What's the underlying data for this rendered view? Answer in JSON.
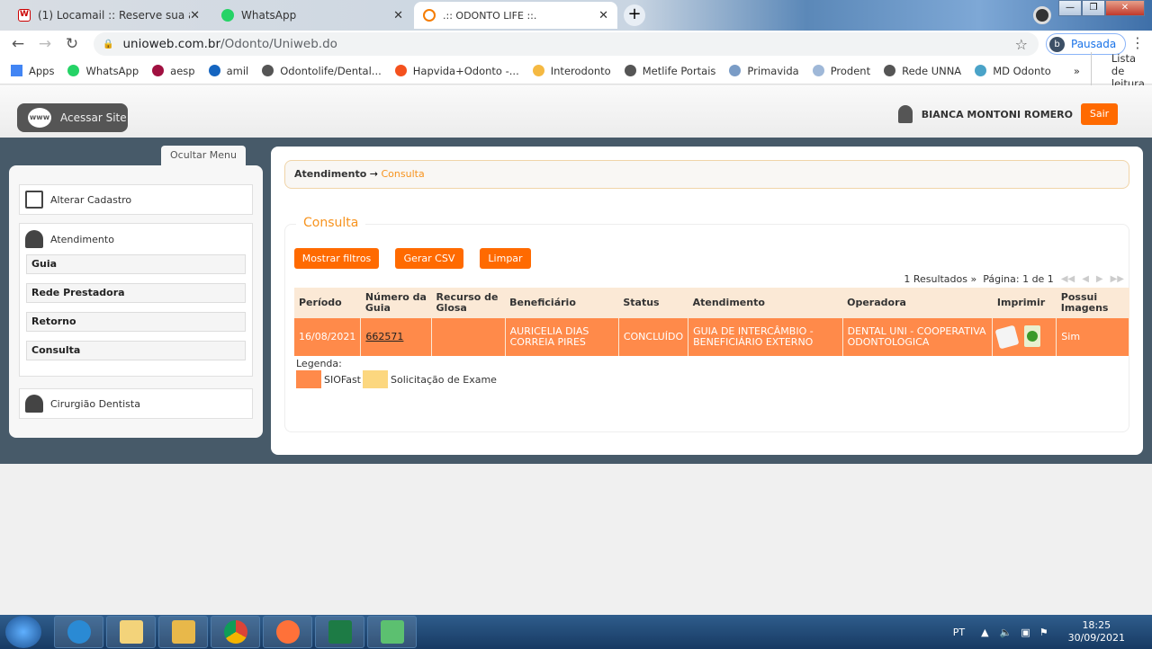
{
  "browser": {
    "tabs": [
      {
        "title": "(1) Locamail :: Reserve sua agend",
        "icon": "w-icon"
      },
      {
        "title": "WhatsApp",
        "icon": "whatsapp-icon"
      },
      {
        "title": ".:: ODONTO LIFE ::.",
        "icon": "firefox-like-icon",
        "active": true
      }
    ],
    "url_host": "unioweb.com.br",
    "url_path": "/Odonto/Uniweb.do",
    "profile_initial": "b",
    "profile_label": "Pausada",
    "bookmarks": [
      {
        "label": "Apps",
        "color": "#4285f4"
      },
      {
        "label": "WhatsApp",
        "color": "#25d366"
      },
      {
        "label": "aesp",
        "color": "#a01040"
      },
      {
        "label": "amil",
        "color": "#1565c0"
      },
      {
        "label": "Odontolife/Dental...",
        "color": "#555555"
      },
      {
        "label": "Hapvida+Odonto -...",
        "color": "#f4511e"
      },
      {
        "label": "Interodonto",
        "color": "#f5b942"
      },
      {
        "label": "Metlife Portais",
        "color": "#555555"
      },
      {
        "label": "Primavida",
        "color": "#7a9cc6"
      },
      {
        "label": "Prodent",
        "color": "#9fb8d8"
      },
      {
        "label": "Rede UNNA",
        "color": "#555555"
      },
      {
        "label": "MD Odonto",
        "color": "#4aa3c8"
      }
    ],
    "more": "»",
    "reading_list": "Lista de leitura"
  },
  "header": {
    "site_button": "Acessar Site",
    "www": "www",
    "user_name": "BIANCA MONTONI ROMERO",
    "logout": "Sair"
  },
  "sidebar": {
    "toggle": "Ocultar Menu",
    "alterar": "Alterar Cadastro",
    "atendimento": "Atendimento",
    "subitems": [
      "Guia",
      "Rede Prestadora",
      "Retorno",
      "Consulta"
    ],
    "cirurgiao": "Cirurgião Dentista"
  },
  "main": {
    "breadcrumb": {
      "parent": "Atendimento",
      "arrow": "→",
      "current": "Consulta"
    },
    "section_title": "Consulta",
    "buttons": {
      "filters": "Mostrar filtros",
      "csv": "Gerar CSV",
      "clear": "Limpar"
    },
    "pager": {
      "results": "1 Resultados »",
      "page": "Página: 1 de 1"
    },
    "columns": [
      "Período",
      "Número da Guia",
      "Recurso de Glosa",
      "Beneficiário",
      "Status",
      "Atendimento",
      "Operadora",
      "Imprimir",
      "Possui Imagens"
    ],
    "rows": [
      {
        "periodo": "16/08/2021",
        "guia": "662571",
        "glosa": "",
        "beneficiario": "AURICELIA DIAS CORREIA PIRES",
        "status": "CONCLUÍDO",
        "atendimento": "GUIA DE INTERCÂMBIO - BENEFICIÁRIO EXTERNO",
        "operadora": "DENTAL UNI - COOPERATIVA ODONTOLOGICA",
        "imagens": "Sim"
      }
    ],
    "legend_label": "Legenda:",
    "legend": [
      {
        "label": "SIOFast",
        "color": "#ff8a4a"
      },
      {
        "label": "Solicitação de Exame",
        "color": "#fcd77f"
      }
    ]
  },
  "taskbar": {
    "lang": "PT",
    "time": "18:25",
    "date": "30/09/2021"
  },
  "colors": {
    "accent": "#ff6a00",
    "row": "#ff8a4a",
    "frame": "#475a69"
  }
}
